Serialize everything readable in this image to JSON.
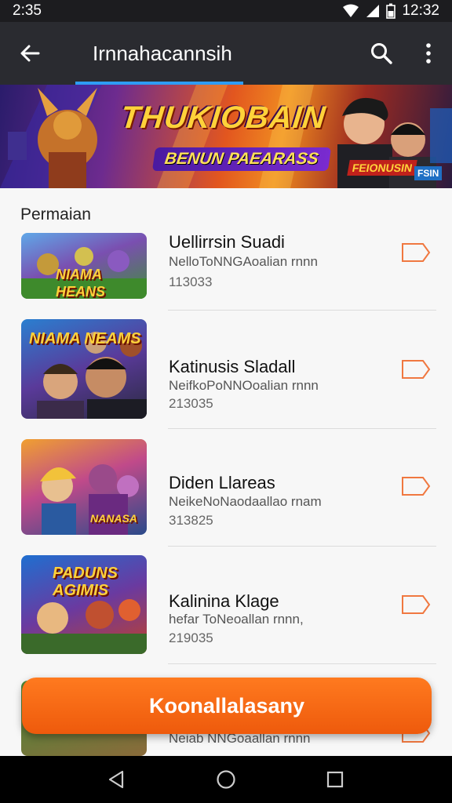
{
  "status": {
    "left_time": "2:35",
    "right_time": "12:32"
  },
  "toolbar": {
    "title": "Irnnahacannsih"
  },
  "banner": {
    "title": "THUKIOBAIN",
    "subtitle": "BENUN PAEARASS",
    "tag1": "FEIONUSIN",
    "tag2": "FSIN"
  },
  "section": {
    "title": "Permaian"
  },
  "games": [
    {
      "name": "Uellirrsin Suadi",
      "subtitle": "NelloToNNGAoalian rnnn",
      "count": "113033",
      "caption": "NIAMA HEANS"
    },
    {
      "name": "Katinusis Sladall",
      "subtitle": "NeifkoPoNNOoalian rnnn",
      "count": "213035",
      "caption": "NIAMA NEAMS"
    },
    {
      "name": "Diden Llareas",
      "subtitle": "NeikeNoNaodaallao rnam",
      "count": "313825",
      "caption": "NANASA"
    },
    {
      "name": "Kalinina Klage",
      "subtitle": "hefar ToNeoallan rnnn,",
      "count": "219035",
      "caption": "PADUNS AGIMIS"
    },
    {
      "name": "",
      "subtitle": "Neiab NNGoaallan rnnn",
      "count": "",
      "caption": ""
    }
  ],
  "cta": {
    "label": "Koonallalasany"
  },
  "colors": {
    "accent": "#ff6a14",
    "toolbar": "#2a2b30",
    "underline": "#2e9cf4"
  },
  "icons": [
    "back-arrow-icon",
    "search-icon",
    "more-vert-icon",
    "tag-icon",
    "nav-back-icon",
    "nav-home-icon",
    "nav-recents-icon"
  ]
}
